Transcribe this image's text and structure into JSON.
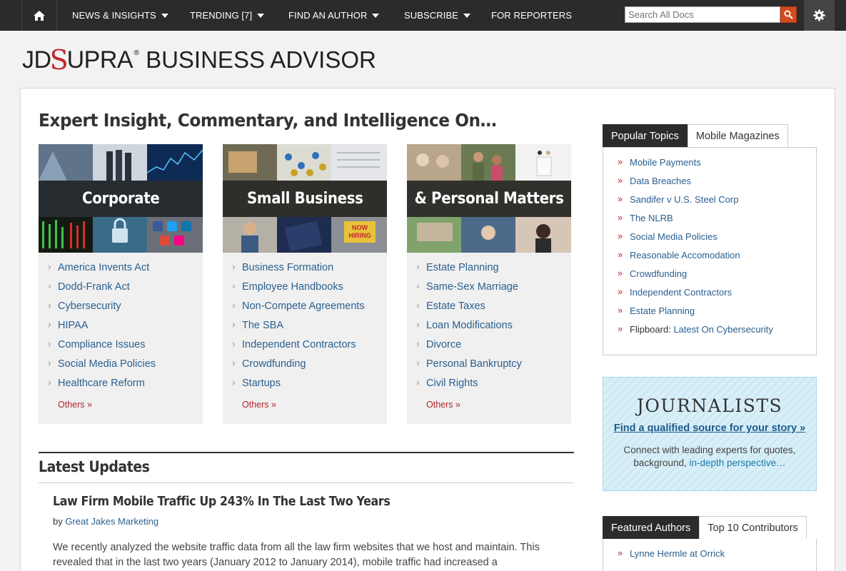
{
  "nav": {
    "items": [
      {
        "label": "NEWS & INSIGHTS",
        "dropdown": true
      },
      {
        "label": "TRENDING [7]",
        "dropdown": true
      },
      {
        "label": "FIND AN AUTHOR",
        "dropdown": true
      },
      {
        "label": "SUBSCRIBE",
        "dropdown": true
      },
      {
        "label": "FOR REPORTERS",
        "dropdown": false
      }
    ],
    "search_placeholder": "Search All Docs",
    "icons": {
      "home": "home-icon",
      "search": "search-icon",
      "settings": "gear-icon"
    }
  },
  "logo": {
    "jd": "JD",
    "s": "S",
    "upra": "UPRA",
    "reg": "®",
    "product": "BUSINESS ADVISOR"
  },
  "headline": "Expert Insight, Commentary, and Intelligence On…",
  "categories": [
    {
      "title": "Corporate",
      "links": [
        "America Invents Act",
        "Dodd-Frank Act",
        "Cybersecurity",
        "HIPAA",
        "Compliance Issues",
        "Social Media Policies",
        "Healthcare Reform"
      ],
      "others": "Others »"
    },
    {
      "title": "Small Business",
      "links": [
        "Business Formation",
        "Employee Handbooks",
        "Non-Compete Agreements",
        "The SBA",
        "Independent Contractors",
        "Crowdfunding",
        "Startups"
      ],
      "others": "Others »",
      "hero_sign": [
        "NOW",
        "HIRING"
      ]
    },
    {
      "title": "& Personal Matters",
      "links": [
        "Estate Planning",
        "Same-Sex Marriage",
        "Estate Taxes",
        "Loan Modifications",
        "Divorce",
        "Personal Bankruptcy",
        "Civil Rights"
      ],
      "others": "Others »"
    }
  ],
  "latest": {
    "section_title": "Latest Updates",
    "article": {
      "title": "Law Firm Mobile Traffic Up 243% In The Last Two Years",
      "by": "by",
      "author": "Great Jakes Marketing",
      "body": "We recently analyzed the website traffic data from all the law firm websites that we host and maintain. This revealed that in the last two years (January 2012 to January 2014), mobile traffic had increased a"
    }
  },
  "sidebar": {
    "topic_tabs": [
      "Popular Topics",
      "Mobile Magazines"
    ],
    "topics": [
      "Mobile Payments",
      "Data Breaches",
      "Sandifer v U.S. Steel Corp",
      "The NLRB",
      "Social Media Policies",
      "Reasonable Accomodation",
      "Crowdfunding",
      "Independent Contractors",
      "Estate Planning"
    ],
    "flipboard_prefix": "Flipboard:",
    "flipboard_link": "Latest On Cybersecurity",
    "journalists": {
      "title": "JOURNALISTS",
      "link": "Find a qualified source for your story »",
      "text": "Connect with leading experts for quotes, background,",
      "text_highlight": "in-depth perspective…"
    },
    "author_tabs": [
      "Featured Authors",
      "Top 10 Contributors"
    ],
    "authors": [
      "Lynne Hermle at Orrick"
    ]
  },
  "colors": {
    "nav_bg": "#2b2b2b",
    "link": "#2a5f8f",
    "accent_red": "#c0272d",
    "search_btn": "#d34a1c",
    "journalists_bg": "#d9eff8"
  }
}
